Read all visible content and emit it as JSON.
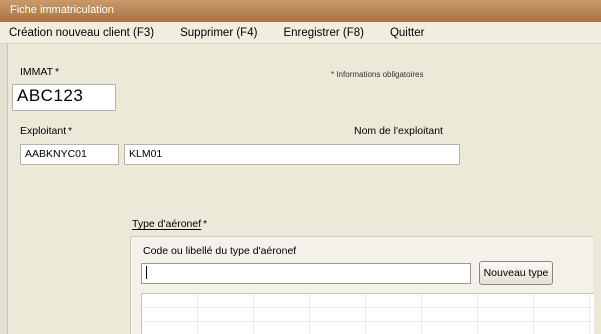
{
  "window": {
    "title": "Fiche immatriculation"
  },
  "menu": {
    "items": [
      {
        "label": "Création nouveau client (F3)"
      },
      {
        "label": "Supprimer (F4)"
      },
      {
        "label": "Enregistrer (F8)"
      },
      {
        "label": "Quitter"
      }
    ]
  },
  "form": {
    "immat": {
      "label": "IMMAT",
      "value": "ABC123"
    },
    "required_marker": "*",
    "required_note": "* Informations obligatoires",
    "exploitant": {
      "label": "Exploitant",
      "code_value": "AABKNYC01",
      "name_value": "KLM01"
    },
    "nom_exploitant_label": "Nom de l'exploitant",
    "type_aeronef": {
      "label": "Type d'aéronef",
      "search_label": "Code ou libellé du type d'aéronef",
      "search_value": "",
      "new_type_button": "Nouveau type"
    }
  },
  "colors": {
    "titlebar": "#b5814f",
    "background": "#ece9d8"
  }
}
